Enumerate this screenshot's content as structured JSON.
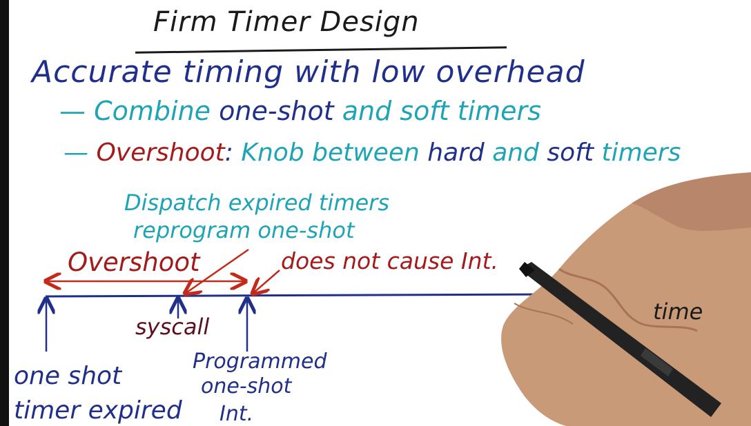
{
  "title": "Firm Timer Design",
  "heading": "Accurate timing with low overhead",
  "bullets": [
    {
      "dash": "—",
      "parts": [
        {
          "text": "Combine",
          "color": "#1ea4b4"
        },
        {
          "text": "one-shot",
          "color": "#1f2f8a"
        },
        {
          "text": "and",
          "color": "#1ea4b4"
        },
        {
          "text": "soft timers",
          "color": "#1ea4b4"
        }
      ]
    },
    {
      "dash": "—",
      "parts": [
        {
          "text": "Overshoot",
          "color": "#a41a1a"
        },
        {
          "text": ":",
          "color": "#1f2f8a"
        },
        {
          "text": "Knob between",
          "color": "#1ea4b4"
        },
        {
          "text": "hard",
          "color": "#1f2f8a"
        },
        {
          "text": "and",
          "color": "#1ea4b4"
        },
        {
          "text": "soft",
          "color": "#1f2f8a"
        },
        {
          "text": "timers",
          "color": "#1ea4b4"
        }
      ]
    }
  ],
  "diagram": {
    "dispatch_line1": "Dispatch expired timers",
    "dispatch_line2": "reprogram one-shot",
    "overshoot_label": "Overshoot",
    "does_not_cause": "does not cause Int.",
    "axis_label": "time",
    "syscall_label": "syscall",
    "oneshot_line1": "one shot",
    "oneshot_line2": "timer expired",
    "programmed_line1": "Programmed",
    "programmed_line2": "one-shot",
    "programmed_line3": "Int."
  },
  "colors": {
    "ink_black": "#1a1a1a",
    "ink_navy": "#1f2f8a",
    "ink_teal": "#1ea4b4",
    "ink_red": "#a41a1a",
    "ink_maroon": "#5a1020",
    "skin": "#c99a78",
    "pen": "#222222"
  }
}
